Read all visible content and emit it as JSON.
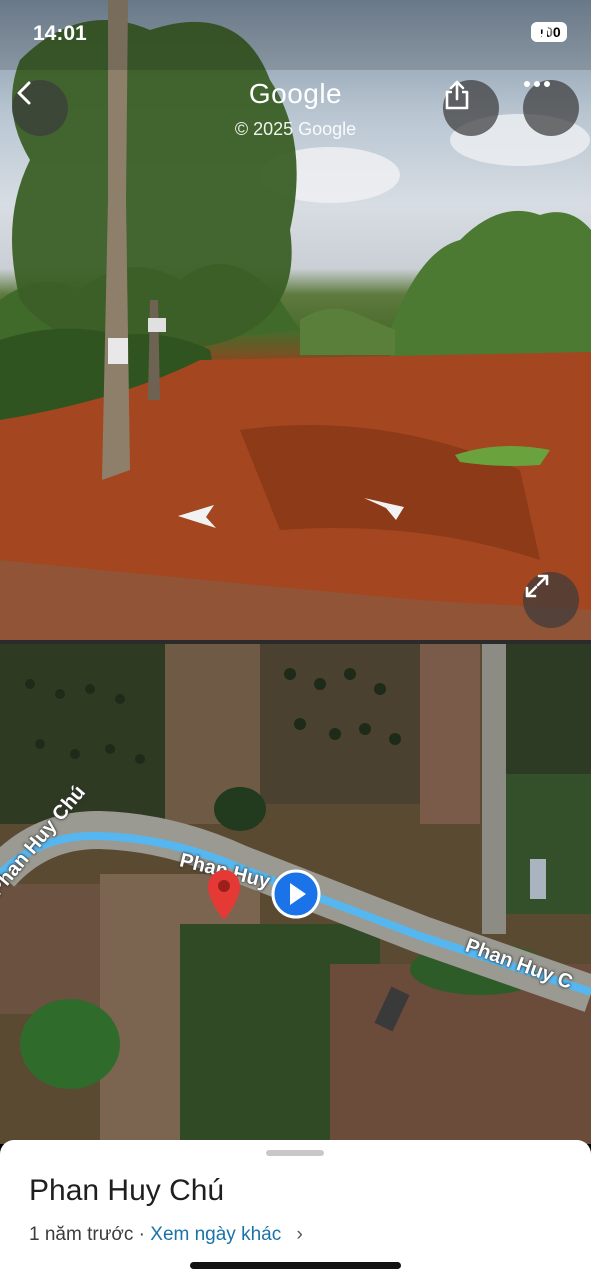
{
  "status_bar": {
    "time": "14:01",
    "battery": "100"
  },
  "street_view": {
    "brand": "Google",
    "copyright": "© 2025 Google",
    "back_icon": "chevron-left-icon",
    "share_icon": "share-icon",
    "more_icon": "more-horizontal-icon",
    "expand_icon": "expand-icon"
  },
  "map": {
    "road_labels": [
      "Phan Huy Chú",
      "Phan Huy Chú",
      "Phan Huy C"
    ],
    "pin_color": "#e53935",
    "heading_marker_color": "#1a73e8"
  },
  "sheet": {
    "place_name": "Phan Huy Chú",
    "captured": "1 năm trước",
    "separator": " · ",
    "other_dates_link": "Xem ngày khác",
    "chevron": "›"
  }
}
